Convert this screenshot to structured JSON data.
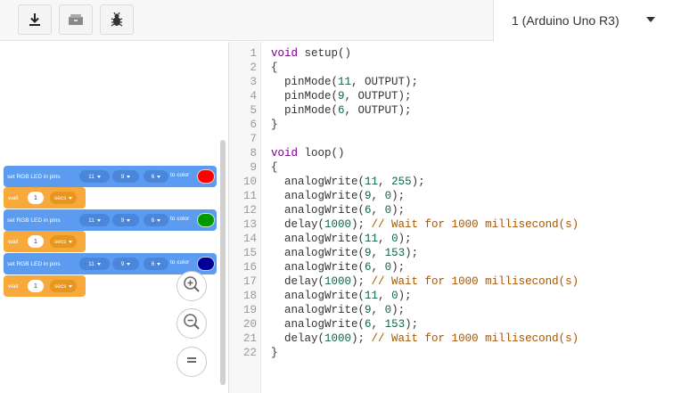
{
  "toolbar": {
    "upload_icon": "download-icon",
    "serial_icon": "serial-monitor-icon",
    "debug_icon": "bug-icon",
    "board_select": {
      "value": "1 (Arduino Uno R3)"
    }
  },
  "blocks": {
    "led_label": "set RGB LED in pins",
    "to_color_label": "to color",
    "wait_label": "wait",
    "secs_label": "secs",
    "led_blocks": [
      {
        "pin_a": "11",
        "pin_b": "9",
        "pin_c": "6",
        "color": "#ff0000"
      },
      {
        "pin_a": "11",
        "pin_b": "9",
        "pin_c": "6",
        "color": "#009900"
      },
      {
        "pin_a": "11",
        "pin_b": "9",
        "pin_c": "6",
        "color": "#000099"
      }
    ],
    "wait_blocks": [
      {
        "value": "1"
      },
      {
        "value": "1"
      },
      {
        "value": "1"
      }
    ]
  },
  "zoom": {
    "in_icon": "zoom-in-icon",
    "out_icon": "zoom-out-icon",
    "reset_icon": "zoom-reset-icon"
  },
  "editor": {
    "line_numbers": [
      "1",
      "2",
      "3",
      "4",
      "5",
      "6",
      "7",
      "8",
      "9",
      "10",
      "11",
      "12",
      "13",
      "14",
      "15",
      "16",
      "17",
      "18",
      "19",
      "20",
      "21",
      "22"
    ],
    "lines": [
      [
        {
          "t": "kw",
          "v": "void"
        },
        {
          "t": "txt",
          "v": " setup()"
        }
      ],
      [
        {
          "t": "txt",
          "v": "{"
        }
      ],
      [
        {
          "t": "txt",
          "v": "  pinMode("
        },
        {
          "t": "num",
          "v": "11"
        },
        {
          "t": "txt",
          "v": ", OUTPUT);"
        }
      ],
      [
        {
          "t": "txt",
          "v": "  pinMode("
        },
        {
          "t": "num",
          "v": "9"
        },
        {
          "t": "txt",
          "v": ", OUTPUT);"
        }
      ],
      [
        {
          "t": "txt",
          "v": "  pinMode("
        },
        {
          "t": "num",
          "v": "6"
        },
        {
          "t": "txt",
          "v": ", OUTPUT);"
        }
      ],
      [
        {
          "t": "txt",
          "v": "}"
        }
      ],
      [
        {
          "t": "txt",
          "v": ""
        }
      ],
      [
        {
          "t": "kw",
          "v": "void"
        },
        {
          "t": "txt",
          "v": " loop()"
        }
      ],
      [
        {
          "t": "txt",
          "v": "{"
        }
      ],
      [
        {
          "t": "txt",
          "v": "  analogWrite("
        },
        {
          "t": "num",
          "v": "11"
        },
        {
          "t": "txt",
          "v": ", "
        },
        {
          "t": "num",
          "v": "255"
        },
        {
          "t": "txt",
          "v": ");"
        }
      ],
      [
        {
          "t": "txt",
          "v": "  analogWrite("
        },
        {
          "t": "num",
          "v": "9"
        },
        {
          "t": "txt",
          "v": ", "
        },
        {
          "t": "num",
          "v": "0"
        },
        {
          "t": "txt",
          "v": ");"
        }
      ],
      [
        {
          "t": "txt",
          "v": "  analogWrite("
        },
        {
          "t": "num",
          "v": "6"
        },
        {
          "t": "txt",
          "v": ", "
        },
        {
          "t": "num",
          "v": "0"
        },
        {
          "t": "txt",
          "v": ");"
        }
      ],
      [
        {
          "t": "txt",
          "v": "  delay("
        },
        {
          "t": "num",
          "v": "1000"
        },
        {
          "t": "txt",
          "v": "); "
        },
        {
          "t": "com",
          "v": "// Wait for 1000 millisecond(s)"
        }
      ],
      [
        {
          "t": "txt",
          "v": "  analogWrite("
        },
        {
          "t": "num",
          "v": "11"
        },
        {
          "t": "txt",
          "v": ", "
        },
        {
          "t": "num",
          "v": "0"
        },
        {
          "t": "txt",
          "v": ");"
        }
      ],
      [
        {
          "t": "txt",
          "v": "  analogWrite("
        },
        {
          "t": "num",
          "v": "9"
        },
        {
          "t": "txt",
          "v": ", "
        },
        {
          "t": "num",
          "v": "153"
        },
        {
          "t": "txt",
          "v": ");"
        }
      ],
      [
        {
          "t": "txt",
          "v": "  analogWrite("
        },
        {
          "t": "num",
          "v": "6"
        },
        {
          "t": "txt",
          "v": ", "
        },
        {
          "t": "num",
          "v": "0"
        },
        {
          "t": "txt",
          "v": ");"
        }
      ],
      [
        {
          "t": "txt",
          "v": "  delay("
        },
        {
          "t": "num",
          "v": "1000"
        },
        {
          "t": "txt",
          "v": "); "
        },
        {
          "t": "com",
          "v": "// Wait for 1000 millisecond(s)"
        }
      ],
      [
        {
          "t": "txt",
          "v": "  analogWrite("
        },
        {
          "t": "num",
          "v": "11"
        },
        {
          "t": "txt",
          "v": ", "
        },
        {
          "t": "num",
          "v": "0"
        },
        {
          "t": "txt",
          "v": ");"
        }
      ],
      [
        {
          "t": "txt",
          "v": "  analogWrite("
        },
        {
          "t": "num",
          "v": "9"
        },
        {
          "t": "txt",
          "v": ", "
        },
        {
          "t": "num",
          "v": "0"
        },
        {
          "t": "txt",
          "v": ");"
        }
      ],
      [
        {
          "t": "txt",
          "v": "  analogWrite("
        },
        {
          "t": "num",
          "v": "6"
        },
        {
          "t": "txt",
          "v": ", "
        },
        {
          "t": "num",
          "v": "153"
        },
        {
          "t": "txt",
          "v": ");"
        }
      ],
      [
        {
          "t": "txt",
          "v": "  delay("
        },
        {
          "t": "num",
          "v": "1000"
        },
        {
          "t": "txt",
          "v": "); "
        },
        {
          "t": "com",
          "v": "// Wait for 1000 millisecond(s)"
        }
      ],
      [
        {
          "t": "txt",
          "v": "}"
        }
      ]
    ]
  }
}
